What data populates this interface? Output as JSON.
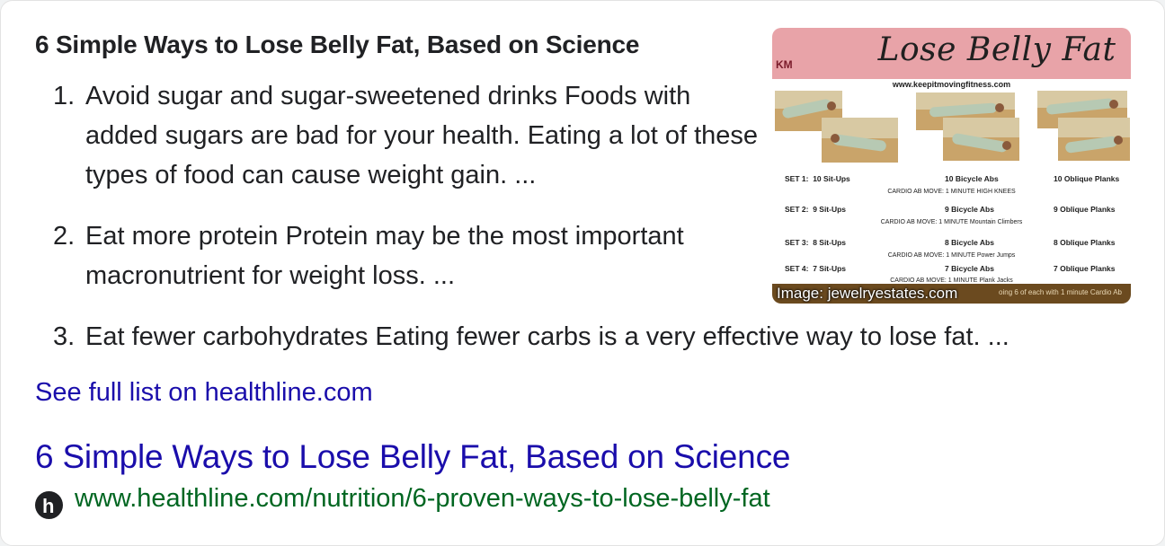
{
  "snippet": {
    "title": "6 Simple Ways to Lose Belly Fat, Based on Science",
    "steps": [
      {
        "num": "1.",
        "text": "Avoid sugar and sugar-sweetened drinks Foods with added sugars are bad for your health. Eating a lot of these types of food can cause weight gain. ..."
      },
      {
        "num": "2.",
        "text": "Eat more protein Protein may be the most important macronutrient for weight loss. ..."
      },
      {
        "num": "3.",
        "text": "Eat fewer carbohydrates Eating fewer carbs is a very effective way to lose fat. ..."
      }
    ],
    "more_link": "See full list on healthline.com"
  },
  "thumbnail": {
    "heading": "Lose Belly Fat",
    "logo": "KM",
    "site": "www.keepitmovingfitness.com",
    "sets": [
      {
        "set": "SET 1:",
        "a": "10 Sit-Ups",
        "b": "10 Bicycle Abs",
        "c": "10 Oblique Planks",
        "cardio": "CARDIO AB MOVE: 1 MINUTE  HIGH KNEES"
      },
      {
        "set": "SET 2:",
        "a": "9 Sit-Ups",
        "b": "9 Bicycle Abs",
        "c": "9 Oblique Planks",
        "cardio": "CARDIO AB MOVE: 1 MINUTE  Mountain Climbers"
      },
      {
        "set": "SET 3:",
        "a": "8 Sit-Ups",
        "b": "8 Bicycle Abs",
        "c": "8 Oblique Planks",
        "cardio": "CARDIO AB MOVE: 1 MINUTE  Power Jumps"
      },
      {
        "set": "SET 4:",
        "a": "7 Sit-Ups",
        "b": "7 Bicycle Abs",
        "c": "7 Oblique Planks",
        "cardio": "CARDIO AB MOVE: 1 MINUTE  Plank Jacks"
      }
    ],
    "footer": "oing 6 of each with 1 minute Cardio Ab",
    "credit": "Image: jewelryestates.com"
  },
  "result": {
    "title": "6 Simple Ways to Lose Belly Fat, Based on Science",
    "url": "www.healthline.com/nutrition/6-proven-ways-to-lose-belly-fat",
    "favicon_letter": "h",
    "favicon_icon": "healthline-icon"
  },
  "colors": {
    "link": "#1a0dab",
    "url": "#006621",
    "text": "#202124",
    "banner": "#e8a3a8"
  }
}
